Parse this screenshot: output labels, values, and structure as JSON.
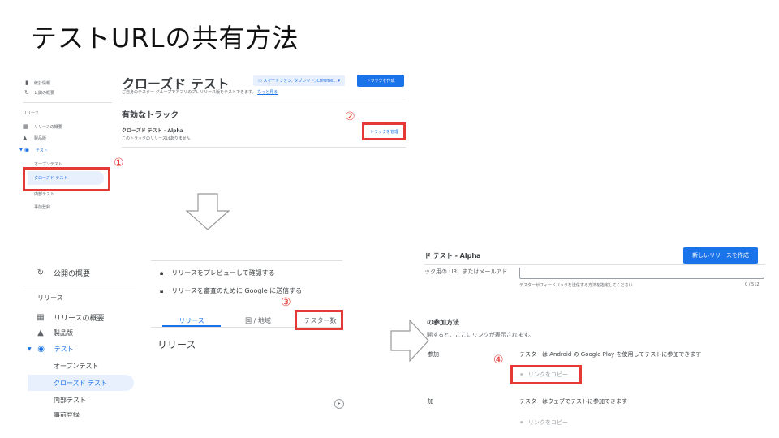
{
  "title": "テストURLの共有方法",
  "p1": {
    "sidebar": {
      "stats": "統計情報",
      "overview": "公開の概要",
      "release_section": "リリース",
      "release_overview": "リリースの概要",
      "bundle": "製品版",
      "testing": "テスト",
      "open_testing": "オープンテスト",
      "closed_testing": "クローズド テスト",
      "internal_testing": "内部テスト",
      "prereg": "事前登録"
    },
    "heading": "クローズド テスト",
    "subtext": "ご自身のテスター グループでアプリのプレリリース版をテストできます。",
    "learn_more": "もっと見る",
    "device_chip": "スマートフォン, タブレット, Chrome...",
    "create_track": "トラックを作成",
    "active_tracks": "有効なトラック",
    "track_name": "クローズド テスト - Alpha",
    "track_sub": "このトラックのリリースはありません",
    "manage_track": "トラックを管理"
  },
  "p2": {
    "sidebar": {
      "overview": "公開の概要",
      "release_section": "リリース",
      "release_overview": "リリースの概要",
      "bundle": "製品版",
      "testing": "テスト",
      "open_testing": "オープンテスト",
      "closed_testing": "クローズド テスト",
      "internal_testing": "内部テスト",
      "prereg": "事前登録"
    },
    "preview": "リリースをプレビューして確認する",
    "submit": "リリースを審査のために Google に送信する",
    "tabs": [
      "リリース",
      "国 / 地域",
      "テスター数"
    ],
    "release_heading": "リリース"
  },
  "p3": {
    "header": "ド テスト - Alpha",
    "new_release": "新しいリリースを作成",
    "feedback_label": "ック用の URL またはメールアド",
    "feedback_hint": "テスターがフィードバックを送信する方法を指定してください",
    "counter": "0 / 512",
    "join_heading": "の参加方法",
    "join_sub": "開すると、ここにリンクが表示されます。",
    "android_label": "参加",
    "android_desc": "テスターは Android の Google Play を使用してテストに参加できます",
    "copy_link_1": "リンクをコピー",
    "web_label": "加",
    "web_desc": "テスターはウェブでテストに参加できます",
    "copy_link_2": "リンクをコピー"
  },
  "markers": {
    "m1": "①",
    "m2": "②",
    "m3": "③",
    "m4": "④"
  },
  "colors": {
    "accent": "#1a73e8",
    "highlight": "#e53935"
  }
}
